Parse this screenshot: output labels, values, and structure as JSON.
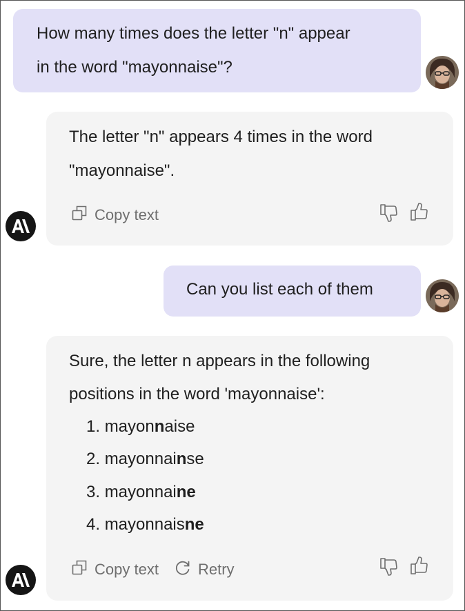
{
  "conversation": {
    "message1": {
      "line1": "How many times does the letter \"n\" appear",
      "line2": "in the word \"mayonnaise\"?"
    },
    "reply1": {
      "line1": "The letter \"n\" appears 4 times in the word",
      "line2": "\"mayonnaise\".",
      "copy_label": "Copy text"
    },
    "message2": {
      "text": "Can you list each of them"
    },
    "reply2": {
      "line1": "Sure, the letter n appears in the following",
      "line2": "positions in the word 'mayonnaise':",
      "items": [
        {
          "number": "1.",
          "before": "mayon",
          "bold": "n",
          "after": "aise"
        },
        {
          "number": "2.",
          "before": "mayonnai",
          "bold": "n",
          "after": "se"
        },
        {
          "number": "3.",
          "before": "mayonnai",
          "bold": "ne",
          "after": ""
        },
        {
          "number": "4.",
          "before": "mayonnais",
          "bold": "ne",
          "after": ""
        }
      ],
      "copy_label": "Copy text",
      "retry_label": "Retry"
    }
  },
  "icons": {
    "copy": "copy-icon",
    "retry": "retry-icon",
    "thumbs_down": "thumbs-down-icon",
    "thumbs_up": "thumbs-up-icon",
    "assistant_logo": "anthropic-logo-icon",
    "user_avatar": "user-avatar"
  },
  "colors": {
    "user_bubble": "#e2e0f7",
    "assistant_card": "#f4f4f4",
    "muted": "#6e6e6e",
    "logo_bg": "#151515"
  }
}
